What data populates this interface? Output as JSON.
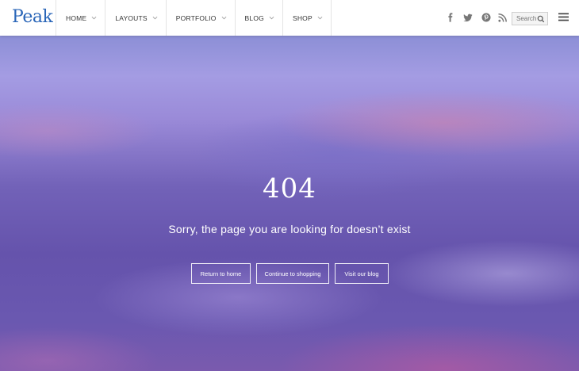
{
  "header": {
    "logo": "Peak",
    "nav": [
      {
        "label": "HOME"
      },
      {
        "label": "LAYOUTS"
      },
      {
        "label": "PORTFOLIO"
      },
      {
        "label": "BLOG"
      },
      {
        "label": "SHOP"
      }
    ],
    "social_icons": [
      "facebook-icon",
      "twitter-icon",
      "pinterest-icon",
      "rss-icon"
    ],
    "search": {
      "placeholder": "Search"
    }
  },
  "main": {
    "error_code": "404",
    "message": "Sorry, the page you are looking for doesn’t exist",
    "buttons": [
      {
        "label": "Return to home"
      },
      {
        "label": "Continue to shopping"
      },
      {
        "label": "Visit our blog"
      }
    ]
  },
  "colors": {
    "logo": "#2a66b8",
    "nav_text": "#333333",
    "hero_text": "#ffffff"
  }
}
